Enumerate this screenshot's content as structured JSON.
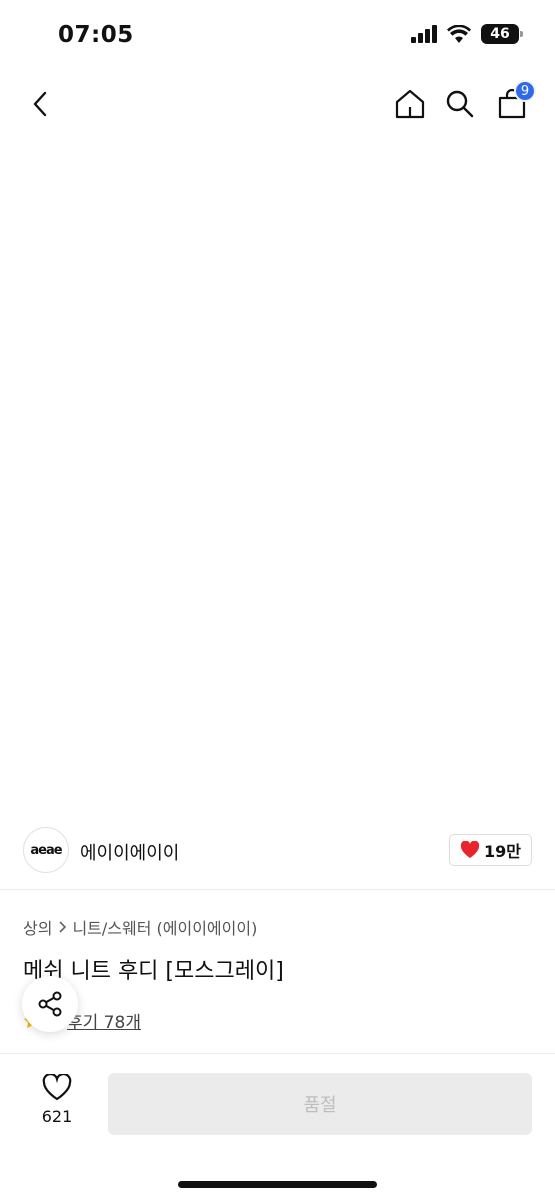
{
  "status_bar": {
    "time": "07:05",
    "battery": "46"
  },
  "nav": {
    "cart_count": "9"
  },
  "brand": {
    "logo_text": "aeae",
    "name": "에이이에이이",
    "likes": "19만"
  },
  "product": {
    "category": "상의",
    "subcategory": "니트/스웨터 (에이이에이이)",
    "title": "메쉬 니트 후디 [모스그레이]",
    "review_link": "후기 78개"
  },
  "bottom": {
    "wish_count": "621",
    "buy_label": "품절"
  },
  "colors": {
    "accent": "#2f6ae8",
    "heart": "#e8242c",
    "star": "#f6b400"
  }
}
